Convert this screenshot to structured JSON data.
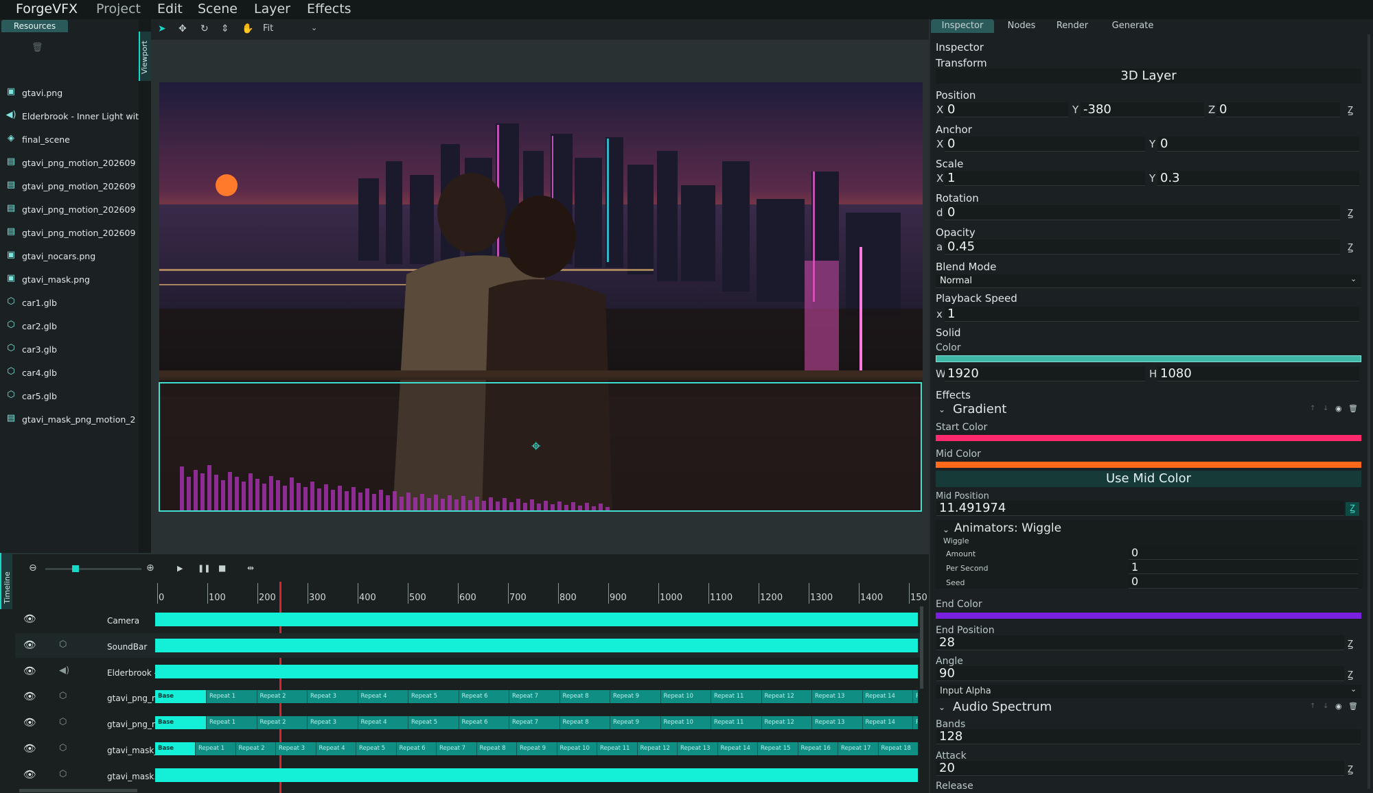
{
  "menu": [
    "ForgeVFX",
    "Project",
    "Edit",
    "Scene",
    "Layer",
    "Effects"
  ],
  "resources": {
    "tab": "Resources",
    "items": [
      {
        "icon": "image-icon",
        "label": "gtavi.png"
      },
      {
        "icon": "audio-icon",
        "label": "Elderbrook - Inner Light with"
      },
      {
        "icon": "layers-icon",
        "label": "final_scene"
      },
      {
        "icon": "motion-file-icon",
        "label": "gtavi_png_motion_202609"
      },
      {
        "icon": "motion-file-icon",
        "label": "gtavi_png_motion_202609"
      },
      {
        "icon": "motion-file-icon",
        "label": "gtavi_png_motion_202609"
      },
      {
        "icon": "motion-file-icon",
        "label": "gtavi_png_motion_202609"
      },
      {
        "icon": "image-icon",
        "label": "gtavi_nocars.png"
      },
      {
        "icon": "image-icon",
        "label": "gtavi_mask.png"
      },
      {
        "icon": "cube-icon",
        "label": "car1.glb"
      },
      {
        "icon": "cube-icon",
        "label": "car2.glb"
      },
      {
        "icon": "cube-icon",
        "label": "car3.glb"
      },
      {
        "icon": "cube-icon",
        "label": "car4.glb"
      },
      {
        "icon": "cube-icon",
        "label": "car5.glb"
      },
      {
        "icon": "motion-file-icon",
        "label": "gtavi_mask_png_motion_2"
      }
    ]
  },
  "viewport": {
    "tab": "Viewport",
    "zoom": "Fit"
  },
  "timeline": {
    "tab": "Timeline",
    "zoom_slider_value": 0.3,
    "ruler": [
      "0",
      "100",
      "200",
      "300",
      "400",
      "500",
      "600",
      "700",
      "800",
      "900",
      "1000",
      "1100",
      "1200",
      "1300",
      "1400",
      "150"
    ],
    "playhead_frame": 245,
    "tracks": [
      {
        "name": "Camera",
        "kind": "camera"
      },
      {
        "name": "SoundBar",
        "kind": "mesh"
      },
      {
        "name": "Elderbrook - Inn",
        "kind": "audio"
      },
      {
        "name": "gtavi_png_moti",
        "kind": "mesh"
      },
      {
        "name": "gtavi_png_moti",
        "kind": "mesh"
      },
      {
        "name": "gtavi_mask_pn",
        "kind": "mesh"
      },
      {
        "name": "gtavi_mask.png",
        "kind": "mesh"
      }
    ],
    "base_label": "Base",
    "repeats_a": [
      "Repeat 1",
      "Repeat 2",
      "Repeat 3",
      "Repeat 4",
      "Repeat 5",
      "Repeat 6",
      "Repeat 7",
      "Repeat 8",
      "Repeat 9",
      "Repeat 10",
      "Repeat 11",
      "Repeat 12",
      "Repeat 13",
      "Repeat 14",
      "R"
    ],
    "repeats_b": [
      "Repeat 1",
      "Repeat 2",
      "Repeat 3",
      "Repeat 4",
      "Repeat 5",
      "Repeat 6",
      "Repeat 7",
      "Repeat 8",
      "Repeat 9",
      "Repeat 10",
      "Repeat 11",
      "Repeat 12",
      "Repeat 13",
      "Repeat 14",
      "Repeat 15",
      "Repeat 16",
      "Repeat 17",
      "Repeat 18"
    ]
  },
  "inspector": {
    "tabs": [
      "Inspector",
      "Nodes",
      "Render",
      "Generate"
    ],
    "title": "Inspector",
    "transform": "Transform",
    "layer_type": "3D Layer",
    "position": {
      "label": "Position",
      "x": "0",
      "y": "-380",
      "z": "0"
    },
    "anchor": {
      "label": "Anchor",
      "x": "0",
      "y": "0"
    },
    "scale": {
      "label": "Scale",
      "x": "1",
      "y": "0.3"
    },
    "rotation": {
      "label": "Rotation",
      "d": "0"
    },
    "opacity": {
      "label": "Opacity",
      "a": "0.45"
    },
    "blend_mode": {
      "label": "Blend Mode",
      "value": "Normal"
    },
    "playback_speed": {
      "label": "Playback Speed",
      "x": "1"
    },
    "solid": {
      "label": "Solid",
      "color_label": "Color",
      "color": "#3fb8a8",
      "w": "1920",
      "h": "1080"
    },
    "effects_label": "Effects",
    "gradient": {
      "title": "Gradient",
      "start_color_label": "Start Color",
      "start_color": "#ff2a6d",
      "mid_color_label": "Mid Color",
      "mid_color": "#ff6a1a",
      "use_mid_color": "Use Mid Color",
      "mid_position_label": "Mid Position",
      "mid_position": "11.491974",
      "animators_title": "Animators: Wiggle",
      "wiggle": {
        "label": "Wiggle",
        "amount_label": "Amount",
        "amount": "0",
        "per_second_label": "Per Second",
        "per_second": "1",
        "seed_label": "Seed",
        "seed": "0"
      },
      "end_color_label": "End Color",
      "end_color": "#7b1fe0",
      "end_position_label": "End Position",
      "end_position": "28",
      "angle_label": "Angle",
      "angle": "90",
      "input_alpha_label": "Input Alpha"
    },
    "audio_spectrum": {
      "title": "Audio Spectrum",
      "bands_label": "Bands",
      "bands": "128",
      "attack_label": "Attack",
      "attack": "20",
      "release_label": "Release"
    }
  }
}
